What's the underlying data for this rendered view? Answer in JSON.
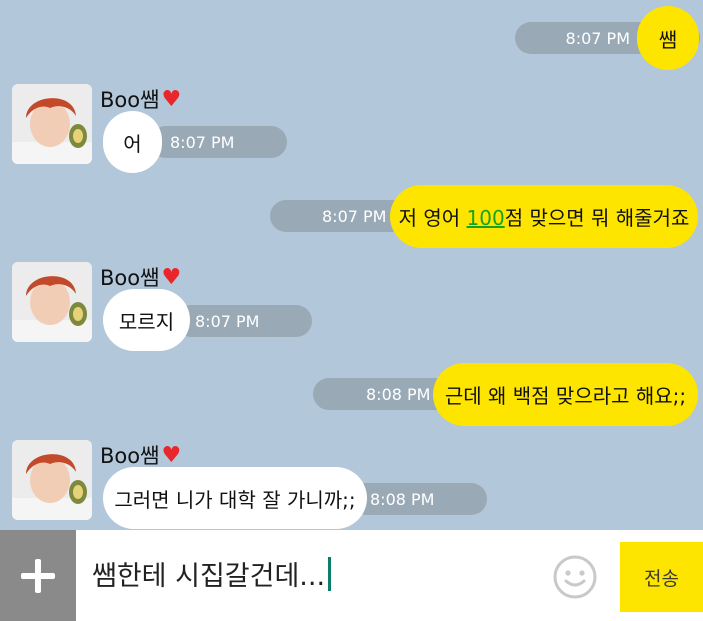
{
  "messages": [
    {
      "side": "me",
      "text": "쌤",
      "time": "8:07 PM"
    },
    {
      "side": "other",
      "sender": "Boo쌤",
      "heart": "♥",
      "text": "어",
      "time": "8:07 PM"
    },
    {
      "side": "me",
      "text_before": "저 영어 ",
      "link_text": "100",
      "text_after": "점 맞으면 뭐 해줄거죠",
      "time": "8:07 PM"
    },
    {
      "side": "other",
      "sender": "Boo쌤",
      "heart": "♥",
      "text": "모르지",
      "time": "8:07 PM"
    },
    {
      "side": "me",
      "text": "근데 왜 백점 맞으라고 해요;;",
      "time": "8:08 PM"
    },
    {
      "side": "other",
      "sender": "Boo쌤",
      "heart": "♥",
      "text": "그러면 니가 대학 잘 가니까;;",
      "time": "8:08 PM"
    }
  ],
  "composer": {
    "text": "쌤한테 시집갈건데...",
    "send_label": "전송",
    "plus_icon": "plus-icon",
    "emoji_icon": "emoji-icon"
  },
  "colors": {
    "background": "#b2c7d9",
    "my_bubble": "#fee500",
    "other_bubble": "#ffffff",
    "time_pill": "#9aa9b6",
    "heart": "#e8262b",
    "link": "#1aa21a"
  }
}
